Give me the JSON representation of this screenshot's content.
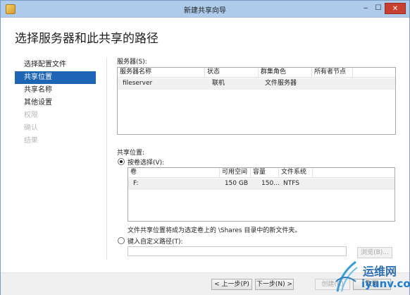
{
  "window": {
    "title": "新建共享向导",
    "controls": {
      "minimize": "‒",
      "maximize": "☐",
      "close": "✕"
    }
  },
  "page": {
    "heading": "选择服务器和此共享的路径"
  },
  "nav": {
    "items": [
      {
        "label": "选择配置文件",
        "state": "normal"
      },
      {
        "label": "共享位置",
        "state": "active"
      },
      {
        "label": "共享名称",
        "state": "normal"
      },
      {
        "label": "其他设置",
        "state": "normal"
      },
      {
        "label": "权限",
        "state": "disabled"
      },
      {
        "label": "确认",
        "state": "disabled"
      },
      {
        "label": "结果",
        "state": "disabled"
      }
    ]
  },
  "servers": {
    "label": "服务器(S):",
    "columns": [
      "服务器名称",
      "状态",
      "群集角色",
      "所有者节点"
    ],
    "rows": [
      {
        "name": "fileserver",
        "status": "联机",
        "role": "文件服务器",
        "owner": ""
      }
    ]
  },
  "share_location": {
    "label": "共享位置:",
    "by_volume": {
      "label": "按卷选择(V):",
      "checked": true
    },
    "volume_columns": [
      "卷",
      "可用空间",
      "容量",
      "文件系统"
    ],
    "volumes": [
      {
        "volume": "F:",
        "free": "150 GB",
        "capacity": "150...",
        "fs": "NTFS"
      }
    ],
    "note": "文件共享位置将成为选定卷上的 \\Shares 目录中的新文件夹。",
    "custom_path": {
      "label": "键入自定义路径(T):",
      "checked": false,
      "value": ""
    },
    "browse_button": "浏览(B)..."
  },
  "footer": {
    "prev_button": "< 上一步(P)",
    "next_button": "下一步(N) >",
    "create_button": "创建(C)",
    "cancel_button": "取消"
  },
  "watermark": {
    "name": "运维网",
    "url": "iyunv.com"
  },
  "colors": {
    "titlebar": "#aecbec",
    "nav_active": "#1e65b5",
    "close_button": "#c84031"
  }
}
